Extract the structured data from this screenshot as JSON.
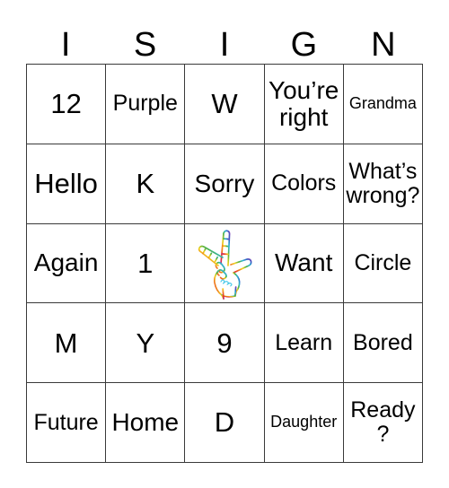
{
  "card": {
    "title_letters": [
      "I",
      "S",
      "I",
      "G",
      "N"
    ],
    "rows": [
      [
        {
          "text": "12",
          "size": "xl"
        },
        {
          "text": "Purple",
          "size": "md"
        },
        {
          "text": "W",
          "size": "xl"
        },
        {
          "text": "You’re right",
          "size": "lg"
        },
        {
          "text": "Grandma",
          "size": "sm"
        }
      ],
      [
        {
          "text": "Hello",
          "size": "xl"
        },
        {
          "text": "K",
          "size": "xl"
        },
        {
          "text": "Sorry",
          "size": "lg"
        },
        {
          "text": "Colors",
          "size": "md"
        },
        {
          "text": "What’s wrong?",
          "size": "md"
        }
      ],
      [
        {
          "text": "Again",
          "size": "lg"
        },
        {
          "text": "1",
          "size": "xl"
        },
        {
          "text": "",
          "size": "md",
          "icon": "ily-hand-icon",
          "free_space": true
        },
        {
          "text": "Want",
          "size": "lg"
        },
        {
          "text": "Circle",
          "size": "md"
        }
      ],
      [
        {
          "text": "M",
          "size": "xl"
        },
        {
          "text": "Y",
          "size": "xl"
        },
        {
          "text": "9",
          "size": "xl"
        },
        {
          "text": "Learn",
          "size": "md"
        },
        {
          "text": "Bored",
          "size": "md"
        }
      ],
      [
        {
          "text": "Future",
          "size": "md"
        },
        {
          "text": "Home",
          "size": "lg"
        },
        {
          "text": "D",
          "size": "xl"
        },
        {
          "text": "Daughter",
          "size": "sm"
        },
        {
          "text": "Ready?",
          "size": "md"
        }
      ]
    ]
  },
  "colors": {
    "grid_line": "#3a3a3a",
    "text": "#000000",
    "background": "#ffffff",
    "ily_gradient": [
      "#e8312a",
      "#f07d1f",
      "#f2d51c",
      "#4caf3f",
      "#2fb8d4",
      "#2f5fc4",
      "#7a3fb5",
      "#b5268f"
    ]
  }
}
